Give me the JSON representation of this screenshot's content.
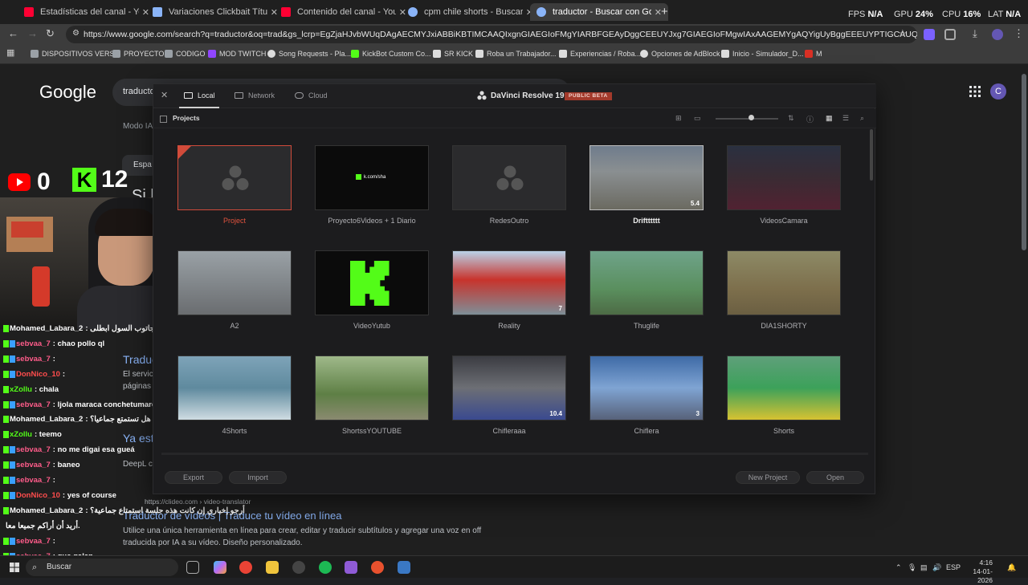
{
  "browser": {
    "tabs": [
      {
        "title": "Estadísticas del canal - YouTube",
        "color": "#ff0033",
        "active": false
      },
      {
        "title": "Variaciones Clickbait Título",
        "color": "#8ab4f8",
        "active": false
      },
      {
        "title": "Contenido del canal - YouTube",
        "color": "#ff0033",
        "active": false
      },
      {
        "title": "cpm chile shorts - Buscar con G",
        "color": "#8ab4f8",
        "active": false
      },
      {
        "title": "traductor - Buscar con Google",
        "color": "#8ab4f8",
        "active": true
      }
    ],
    "new_tab": "+",
    "perf": {
      "fps_label": "FPS",
      "fps_value": "N/A",
      "gpu_label": "GPU",
      "gpu_value": "24%",
      "cpu_label": "CPU",
      "cpu_value": "16%",
      "lat_label": "LAT",
      "lat_value": "N/A"
    },
    "window_controls": {
      "minimize": "—",
      "maximize": "☐",
      "close": "✕"
    },
    "url": "https://www.google.com/search?q=traductor&oq=trad&gs_lcrp=EgZjaHJvbWUqDAgAECMYJxiABBiKBTIMCAAQIxgnGIAEGIoFMgYIARBFGEAyDggCEEUYJxg7GIAEGIoFMgwIAxAAGEMYgAQYigUyBggEEEUYPTIGCAUQRRg8MgYIBhBFGDwyBggHE...",
    "bookmarks": [
      {
        "label": "DISPOSITIVOS VERSE",
        "color": "#9aa0a6"
      },
      {
        "label": "PROYECTOS",
        "color": "#9aa0a6"
      },
      {
        "label": "CODIGO",
        "color": "#9aa0a6"
      },
      {
        "label": "MOD TWITCH",
        "color": "#9146ff"
      },
      {
        "label": "Song Requests - Pla...",
        "color": "#dddddd"
      },
      {
        "label": "KickBot Custom Co...",
        "color": "#53fc18"
      },
      {
        "label": "SR KICK",
        "color": "#dddddd"
      },
      {
        "label": "Roba un Trabajador...",
        "color": "#dddddd"
      },
      {
        "label": "Experiencias / Roba...",
        "color": "#dddddd"
      },
      {
        "label": "Opciones de AdBlock",
        "color": "#dddddd"
      },
      {
        "label": "Inicio - Simulador_D...",
        "color": "#dddddd"
      },
      {
        "label": "M",
        "color": "#d93025"
      }
    ]
  },
  "google": {
    "logo": "Google",
    "query": "traducto",
    "modo_ia": "Modo IA",
    "lang_chip": "Espa",
    "avatar_letter": "C",
    "fragments": {
      "si": "Si l",
      "traduc": "Traduc",
      "el_servici": "El servici",
      "paginas": "páginas",
      "ya_est": "Ya est",
      "deepl": "DeepL c",
      "clideo_url": "https://clideo.com › video-translator",
      "result_title": "Traductor de vídeos | Traduce tu vídeo en línea",
      "result_desc1": "Utilice una única herramienta en línea para crear, editar y traducir subtítulos y agregar una voz en off",
      "result_desc2": "traducida por IA a su vídeo. Diseño personalizado."
    }
  },
  "overlay": {
    "youtube_viewers": "0",
    "kick_viewers": "12",
    "chat": [
      {
        "user": "Mohamed_Labara_2",
        "msg": ": اشتراكیمشحبه جاتوب السول ابطلی",
        "color": "#ffffff"
      },
      {
        "user": "sebvaa_7",
        "msg": ": chao pollo ql",
        "color": "#ff5c8a"
      },
      {
        "user": "sebvaa_7",
        "msg": ":",
        "color": "#ff5c8a"
      },
      {
        "user": "DonNico_10",
        "msg": ":",
        "color": "#ff4d4d"
      },
      {
        "user": "xZollu",
        "msg": ": chala",
        "color": "#53fc18"
      },
      {
        "user": "sebvaa_7",
        "msg": ": ljola maraca conchetumare",
        "color": "#ff5c8a"
      },
      {
        "user": "Mohamed_Labara_2",
        "msg": ": هل تستمتع جماعیا؟",
        "color": "#ffffff"
      },
      {
        "user": "xZollu",
        "msg": ": teemo",
        "color": "#53fc18"
      },
      {
        "user": "sebvaa_7",
        "msg": ": no me digai esa gueá",
        "color": "#ff5c8a"
      },
      {
        "user": "sebvaa_7",
        "msg": ": baneo",
        "color": "#ff5c8a"
      },
      {
        "user": "sebvaa_7",
        "msg": ":",
        "color": "#ff5c8a"
      },
      {
        "user": "DonNico_10",
        "msg": ": yes of course",
        "color": "#ff4d4d"
      },
      {
        "user": "Mohamed_Labara_2",
        "msg": ": أرجو إخباري إن كانت هذه جلسة استمتاع جماعية؟",
        "color": "#ffffff"
      },
      {
        "user": "",
        "msg": "أريد أن أراكم جميعا معا.",
        "color": "#ffffff"
      },
      {
        "user": "sebvaa_7",
        "msg": ":",
        "color": "#ff5c8a"
      },
      {
        "user": "sebvaa_7",
        "msg": ": que galan",
        "color": "#ff5c8a"
      }
    ]
  },
  "davinci": {
    "tabs": {
      "local": "Local",
      "network": "Network",
      "cloud": "Cloud"
    },
    "brand": "DaVinci Resolve 19",
    "beta": "PUBLIC BETA",
    "section": "Projects",
    "projects": [
      {
        "name": "Project",
        "state": "selected",
        "thumb": "logo"
      },
      {
        "name": "Proyecto6Videos + 1 Diario",
        "state": "",
        "thumb": "kick-url"
      },
      {
        "name": "RedesOutro",
        "state": "",
        "thumb": "logo"
      },
      {
        "name": "Driftttttt",
        "state": "hover",
        "thumb": "drift"
      },
      {
        "name": "VideosCamara",
        "state": "",
        "thumb": "camara"
      },
      {
        "name": "A2",
        "state": "",
        "thumb": "street"
      },
      {
        "name": "VideoYutub",
        "state": "",
        "thumb": "kick-logo"
      },
      {
        "name": "Reality",
        "state": "",
        "thumb": "ramp"
      },
      {
        "name": "Thuglife",
        "state": "",
        "thumb": "thug"
      },
      {
        "name": "DIA1SHORTY",
        "state": "",
        "thumb": "dirt"
      },
      {
        "name": "4Shorts",
        "state": "",
        "thumb": "boat"
      },
      {
        "name": "ShortssYOUTUBE",
        "state": "",
        "thumb": "palm"
      },
      {
        "name": "Chifleraaa",
        "state": "",
        "thumb": "bridge"
      },
      {
        "name": "Chiflera",
        "state": "",
        "thumb": "sky"
      },
      {
        "name": "Shorts",
        "state": "",
        "thumb": "green"
      }
    ],
    "kick_url_text": "k.com/sha",
    "badges": {
      "drift": "5.4",
      "ramp": "7",
      "bridge": "10.4",
      "sky": "3"
    },
    "buttons": {
      "export": "Export",
      "import": "Import",
      "new_project": "New Project",
      "open": "Open"
    }
  },
  "taskbar": {
    "search": "Buscar",
    "lang": "ESP",
    "time": "4:16",
    "date": "14-01-2026"
  }
}
